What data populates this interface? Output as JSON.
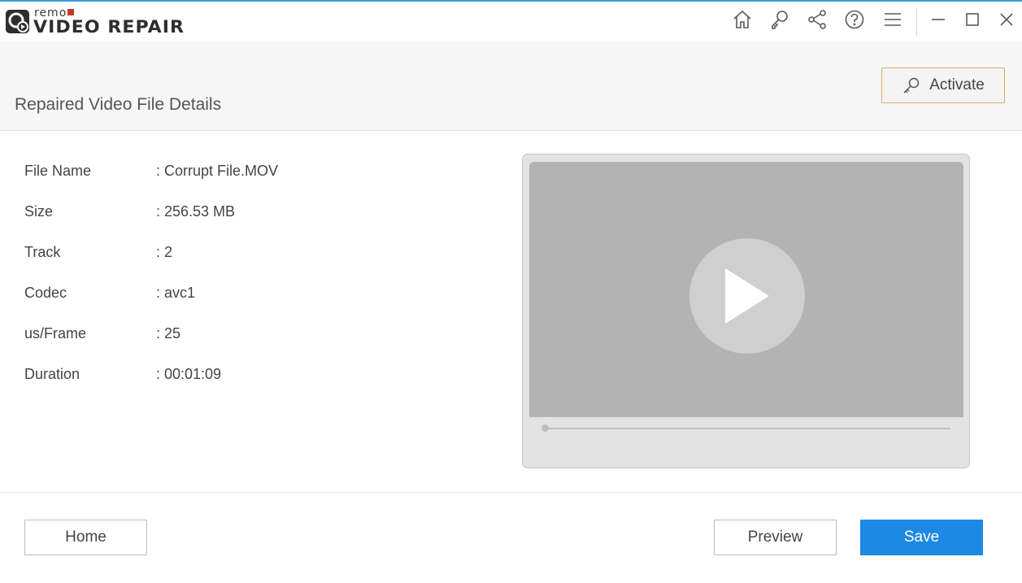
{
  "app": {
    "logo_small": "remo",
    "logo_main": "VIDEO REPAIR"
  },
  "titlebar": {
    "icons": [
      "home-icon",
      "key-icon",
      "share-icon",
      "help-icon",
      "menu-icon",
      "minimize-icon",
      "maximize-icon",
      "close-icon"
    ]
  },
  "header": {
    "title": "Repaired Video File Details",
    "activate_label": "Activate"
  },
  "details": [
    {
      "label": "File Name",
      "value": ": Corrupt File.MOV"
    },
    {
      "label": "Size",
      "value": ": 256.53 MB"
    },
    {
      "label": "Track",
      "value": ": 2"
    },
    {
      "label": "Codec",
      "value": ": avc1"
    },
    {
      "label": "us/Frame",
      "value": ": 25"
    },
    {
      "label": "Duration",
      "value": ": 00:01:09"
    }
  ],
  "player": {
    "progress": 0
  },
  "footer": {
    "home_label": "Home",
    "preview_label": "Preview",
    "save_label": "Save"
  },
  "colors": {
    "accent": "#1e88e5",
    "activate_border": "#d8ae6a",
    "logo_accent": "#c0392b"
  }
}
